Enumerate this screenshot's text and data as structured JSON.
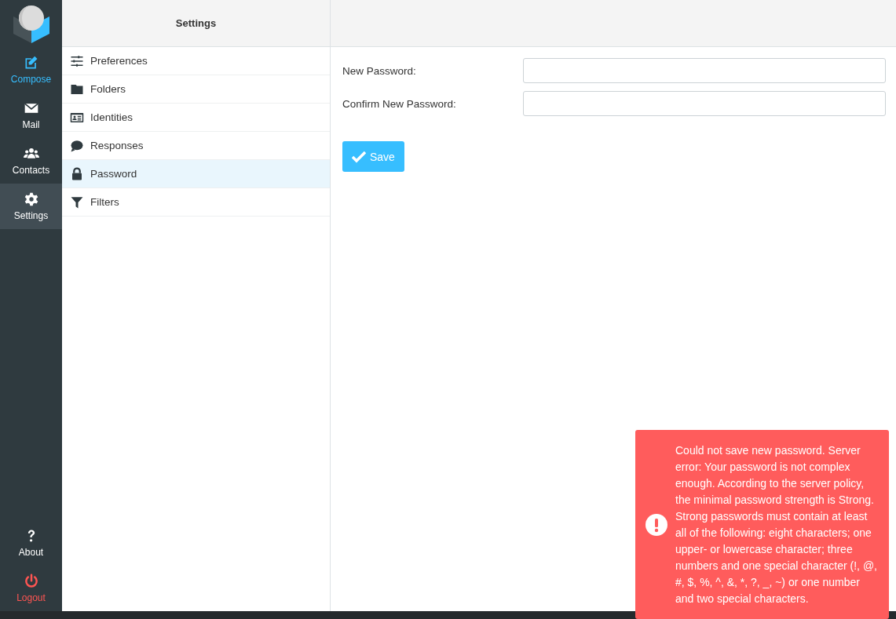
{
  "nav": {
    "items": [
      {
        "label": "Compose",
        "kind": "primary",
        "selected": false
      },
      {
        "label": "Mail",
        "kind": "normal",
        "selected": false
      },
      {
        "label": "Contacts",
        "kind": "normal",
        "selected": false
      },
      {
        "label": "Settings",
        "kind": "normal",
        "selected": true
      }
    ],
    "bottom": [
      {
        "label": "About",
        "kind": "normal",
        "selected": false
      },
      {
        "label": "Logout",
        "kind": "danger",
        "selected": false
      }
    ]
  },
  "settings": {
    "title": "Settings",
    "items": [
      {
        "label": "Preferences",
        "selected": false
      },
      {
        "label": "Folders",
        "selected": false
      },
      {
        "label": "Identities",
        "selected": false
      },
      {
        "label": "Responses",
        "selected": false
      },
      {
        "label": "Password",
        "selected": true
      },
      {
        "label": "Filters",
        "selected": false
      }
    ]
  },
  "form": {
    "fields": [
      {
        "label": "New Password:"
      },
      {
        "label": "Confirm New Password:"
      }
    ],
    "save_button": "Save"
  },
  "error_toast": {
    "message": "Could not save new password. Server error: Your password is not complex enough. According to the server policy, the minimal password strength is Strong. Strong passwords must contain at least all of the following: eight characters; one upper- or lowercase character; three numbers and one special character (!, @, #, $, %, ^, &, *, ?, _, ~) or one number and two special characters."
  }
}
